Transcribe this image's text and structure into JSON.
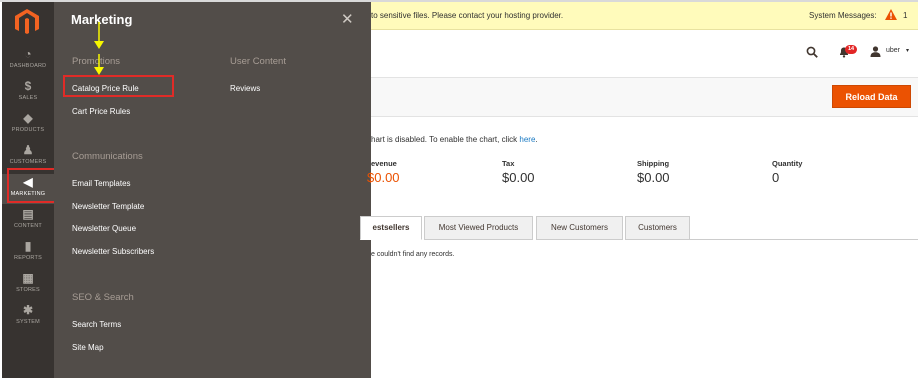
{
  "nav": {
    "items": [
      {
        "label": "DASHBOARD",
        "icon": "dashboard-icon",
        "glyph": "◔"
      },
      {
        "label": "SALES",
        "icon": "dollar-icon",
        "glyph": "$"
      },
      {
        "label": "PRODUCTS",
        "icon": "cube-icon",
        "glyph": "◆"
      },
      {
        "label": "CUSTOMERS",
        "icon": "person-icon",
        "glyph": "♟"
      },
      {
        "label": "MARKETING",
        "icon": "megaphone-icon",
        "glyph": "◀"
      },
      {
        "label": "CONTENT",
        "icon": "content-icon",
        "glyph": "▤"
      },
      {
        "label": "REPORTS",
        "icon": "bar-chart-icon",
        "glyph": "▮"
      },
      {
        "label": "STORES",
        "icon": "store-icon",
        "glyph": "▦"
      },
      {
        "label": "SYSTEM",
        "icon": "gear-icon",
        "glyph": "✱"
      }
    ]
  },
  "flyout": {
    "title": "Marketing",
    "close_glyph": "✕",
    "sections": {
      "promotions": {
        "title": "Promotions",
        "links": [
          "Catalog Price Rule",
          "Cart Price Rules"
        ]
      },
      "user_content": {
        "title": "User Content",
        "links": [
          "Reviews"
        ]
      },
      "communications": {
        "title": "Communications",
        "links": [
          "Email Templates",
          "Newsletter Template",
          "Newsletter Queue",
          "Newsletter Subscribers"
        ]
      },
      "seo": {
        "title": "SEO & Search",
        "links": [
          "Search Terms",
          "Site Map"
        ]
      }
    }
  },
  "message_bar": {
    "text": "to sensitive files. Please contact your hosting provider.",
    "system_label": "System Messages:",
    "system_count": "1"
  },
  "header": {
    "notification_count": "14",
    "user_name": "uber",
    "caret": "▾"
  },
  "actions": {
    "reload_label": "Reload Data"
  },
  "dashboard": {
    "chart_note": "hart is disabled. To enable the chart, click ",
    "chart_link": "here",
    "chart_note_end": ".",
    "metrics": [
      {
        "label": "evenue",
        "value": "$0.00"
      },
      {
        "label": "Tax",
        "value": "$0.00"
      },
      {
        "label": "Shipping",
        "value": "$0.00"
      },
      {
        "label": "Quantity",
        "value": "0"
      }
    ],
    "tabs": [
      "estsellers",
      "Most Viewed Products",
      "New Customers",
      "Customers"
    ],
    "no_records": "e couldn't find any records."
  },
  "colors": {
    "accent": "#eb5202",
    "highlight": "#e02b27",
    "arrow": "#f7f700"
  }
}
